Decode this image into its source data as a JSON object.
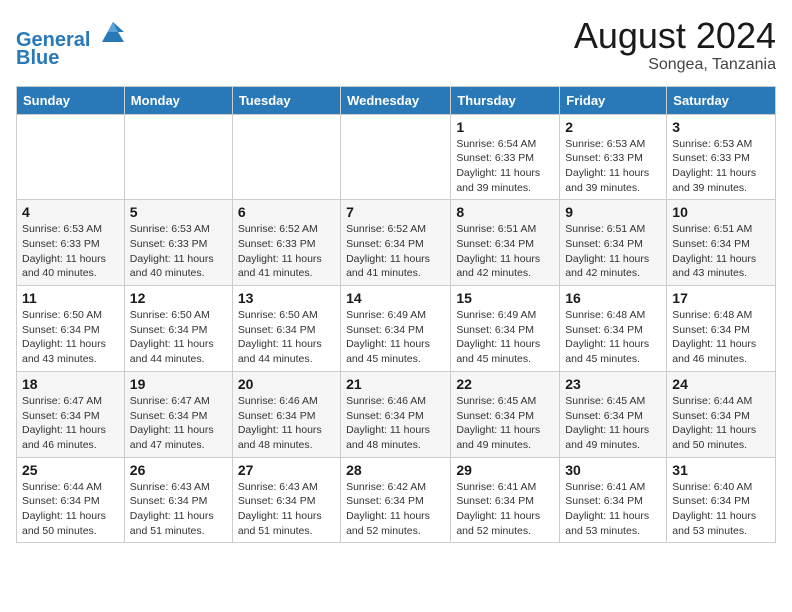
{
  "header": {
    "logo_line1": "General",
    "logo_line2": "Blue",
    "month_year": "August 2024",
    "location": "Songea, Tanzania"
  },
  "weekdays": [
    "Sunday",
    "Monday",
    "Tuesday",
    "Wednesday",
    "Thursday",
    "Friday",
    "Saturday"
  ],
  "weeks": [
    [
      {
        "day": "",
        "info": ""
      },
      {
        "day": "",
        "info": ""
      },
      {
        "day": "",
        "info": ""
      },
      {
        "day": "",
        "info": ""
      },
      {
        "day": "1",
        "info": "Sunrise: 6:54 AM\nSunset: 6:33 PM\nDaylight: 11 hours and 39 minutes."
      },
      {
        "day": "2",
        "info": "Sunrise: 6:53 AM\nSunset: 6:33 PM\nDaylight: 11 hours and 39 minutes."
      },
      {
        "day": "3",
        "info": "Sunrise: 6:53 AM\nSunset: 6:33 PM\nDaylight: 11 hours and 39 minutes."
      }
    ],
    [
      {
        "day": "4",
        "info": "Sunrise: 6:53 AM\nSunset: 6:33 PM\nDaylight: 11 hours and 40 minutes."
      },
      {
        "day": "5",
        "info": "Sunrise: 6:53 AM\nSunset: 6:33 PM\nDaylight: 11 hours and 40 minutes."
      },
      {
        "day": "6",
        "info": "Sunrise: 6:52 AM\nSunset: 6:33 PM\nDaylight: 11 hours and 41 minutes."
      },
      {
        "day": "7",
        "info": "Sunrise: 6:52 AM\nSunset: 6:34 PM\nDaylight: 11 hours and 41 minutes."
      },
      {
        "day": "8",
        "info": "Sunrise: 6:51 AM\nSunset: 6:34 PM\nDaylight: 11 hours and 42 minutes."
      },
      {
        "day": "9",
        "info": "Sunrise: 6:51 AM\nSunset: 6:34 PM\nDaylight: 11 hours and 42 minutes."
      },
      {
        "day": "10",
        "info": "Sunrise: 6:51 AM\nSunset: 6:34 PM\nDaylight: 11 hours and 43 minutes."
      }
    ],
    [
      {
        "day": "11",
        "info": "Sunrise: 6:50 AM\nSunset: 6:34 PM\nDaylight: 11 hours and 43 minutes."
      },
      {
        "day": "12",
        "info": "Sunrise: 6:50 AM\nSunset: 6:34 PM\nDaylight: 11 hours and 44 minutes."
      },
      {
        "day": "13",
        "info": "Sunrise: 6:50 AM\nSunset: 6:34 PM\nDaylight: 11 hours and 44 minutes."
      },
      {
        "day": "14",
        "info": "Sunrise: 6:49 AM\nSunset: 6:34 PM\nDaylight: 11 hours and 45 minutes."
      },
      {
        "day": "15",
        "info": "Sunrise: 6:49 AM\nSunset: 6:34 PM\nDaylight: 11 hours and 45 minutes."
      },
      {
        "day": "16",
        "info": "Sunrise: 6:48 AM\nSunset: 6:34 PM\nDaylight: 11 hours and 45 minutes."
      },
      {
        "day": "17",
        "info": "Sunrise: 6:48 AM\nSunset: 6:34 PM\nDaylight: 11 hours and 46 minutes."
      }
    ],
    [
      {
        "day": "18",
        "info": "Sunrise: 6:47 AM\nSunset: 6:34 PM\nDaylight: 11 hours and 46 minutes."
      },
      {
        "day": "19",
        "info": "Sunrise: 6:47 AM\nSunset: 6:34 PM\nDaylight: 11 hours and 47 minutes."
      },
      {
        "day": "20",
        "info": "Sunrise: 6:46 AM\nSunset: 6:34 PM\nDaylight: 11 hours and 48 minutes."
      },
      {
        "day": "21",
        "info": "Sunrise: 6:46 AM\nSunset: 6:34 PM\nDaylight: 11 hours and 48 minutes."
      },
      {
        "day": "22",
        "info": "Sunrise: 6:45 AM\nSunset: 6:34 PM\nDaylight: 11 hours and 49 minutes."
      },
      {
        "day": "23",
        "info": "Sunrise: 6:45 AM\nSunset: 6:34 PM\nDaylight: 11 hours and 49 minutes."
      },
      {
        "day": "24",
        "info": "Sunrise: 6:44 AM\nSunset: 6:34 PM\nDaylight: 11 hours and 50 minutes."
      }
    ],
    [
      {
        "day": "25",
        "info": "Sunrise: 6:44 AM\nSunset: 6:34 PM\nDaylight: 11 hours and 50 minutes."
      },
      {
        "day": "26",
        "info": "Sunrise: 6:43 AM\nSunset: 6:34 PM\nDaylight: 11 hours and 51 minutes."
      },
      {
        "day": "27",
        "info": "Sunrise: 6:43 AM\nSunset: 6:34 PM\nDaylight: 11 hours and 51 minutes."
      },
      {
        "day": "28",
        "info": "Sunrise: 6:42 AM\nSunset: 6:34 PM\nDaylight: 11 hours and 52 minutes."
      },
      {
        "day": "29",
        "info": "Sunrise: 6:41 AM\nSunset: 6:34 PM\nDaylight: 11 hours and 52 minutes."
      },
      {
        "day": "30",
        "info": "Sunrise: 6:41 AM\nSunset: 6:34 PM\nDaylight: 11 hours and 53 minutes."
      },
      {
        "day": "31",
        "info": "Sunrise: 6:40 AM\nSunset: 6:34 PM\nDaylight: 11 hours and 53 minutes."
      }
    ]
  ]
}
